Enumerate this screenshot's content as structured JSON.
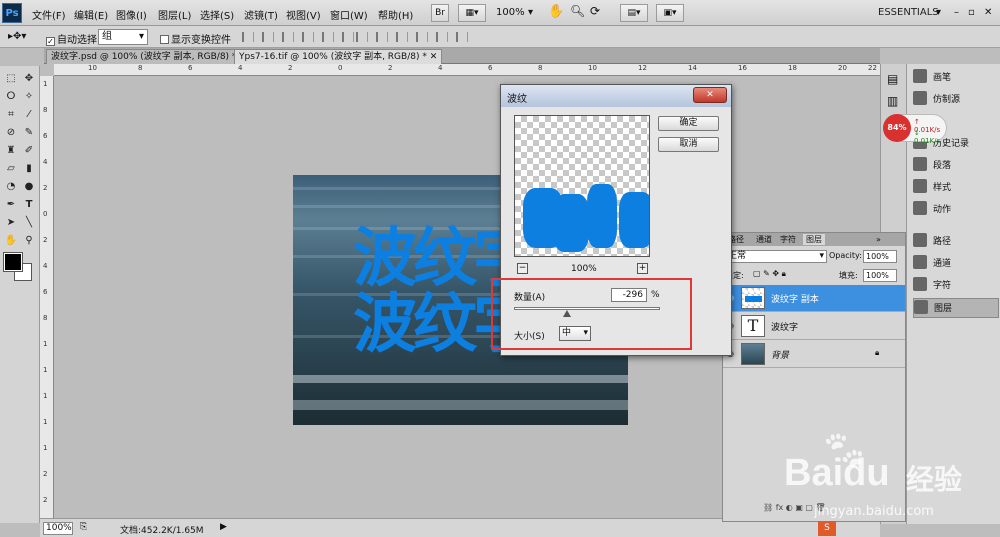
{
  "app": {
    "logo": "Ps",
    "menu": [
      "文件(F)",
      "编辑(E)",
      "图像(I)",
      "图层(L)",
      "选择(S)",
      "滤镜(T)",
      "视图(V)",
      "窗口(W)",
      "帮助(H)"
    ],
    "toolbar_zoom": "100%",
    "workspace": "ESSENTIALS",
    "bridge_label": "Br"
  },
  "options_bar": {
    "auto_select_label": "自动选择:",
    "auto_select_value": "组",
    "show_transform_label": "显示变换控件"
  },
  "tabs": [
    {
      "label": "波纹字.psd @ 100% (波纹字 副本, RGB/8) *"
    },
    {
      "label": "Yps7-16.tif @ 100% (波纹字 副本, RGB/8) *"
    }
  ],
  "rulers": {
    "top": [
      "10",
      "8",
      "6",
      "4",
      "2",
      "0",
      "2",
      "4",
      "6",
      "8",
      "10",
      "12",
      "14",
      "16",
      "18",
      "20",
      "22"
    ],
    "left": [
      "1",
      "8",
      "6",
      "4",
      "2",
      "0",
      "2",
      "4",
      "6",
      "8",
      "1",
      "1",
      "1",
      "1",
      "1",
      "2",
      "2"
    ]
  },
  "canvas": {
    "text_line1": "波纹字",
    "text_line2": "波纹字"
  },
  "status": {
    "zoom": "100%",
    "doc": "文档:452.2K/1.65M"
  },
  "dialog": {
    "title": "波纹",
    "ok": "确定",
    "cancel": "取消",
    "preview_zoom": "100%",
    "amount_label": "数量(A)",
    "amount_value": "-296",
    "amount_unit": "%",
    "size_label": "大小(S)",
    "size_value": "中"
  },
  "right_panel": {
    "items": [
      "画笔",
      "仿制源",
      "历史记录",
      "段落",
      "样式",
      "动作",
      "路径",
      "通道",
      "字符",
      "图层"
    ],
    "net_percent": "84%",
    "net_up": "0.01K/s",
    "net_down": "0.01K/s"
  },
  "layers": {
    "tabs": [
      "路径",
      "通道",
      "字符",
      "图层"
    ],
    "blend_mode": "正常",
    "opacity_label": "Opacity:",
    "opacity_value": "100%",
    "lock_label": "锁定:",
    "fill_label": "填充:",
    "fill_value": "100%",
    "rows": [
      {
        "name": "波纹字 副本"
      },
      {
        "name": "波纹字"
      },
      {
        "name": "背景"
      }
    ]
  },
  "watermark": {
    "brand": "Baidu",
    "brand_suffix": "经验",
    "url": "jingyan.baidu.com"
  }
}
